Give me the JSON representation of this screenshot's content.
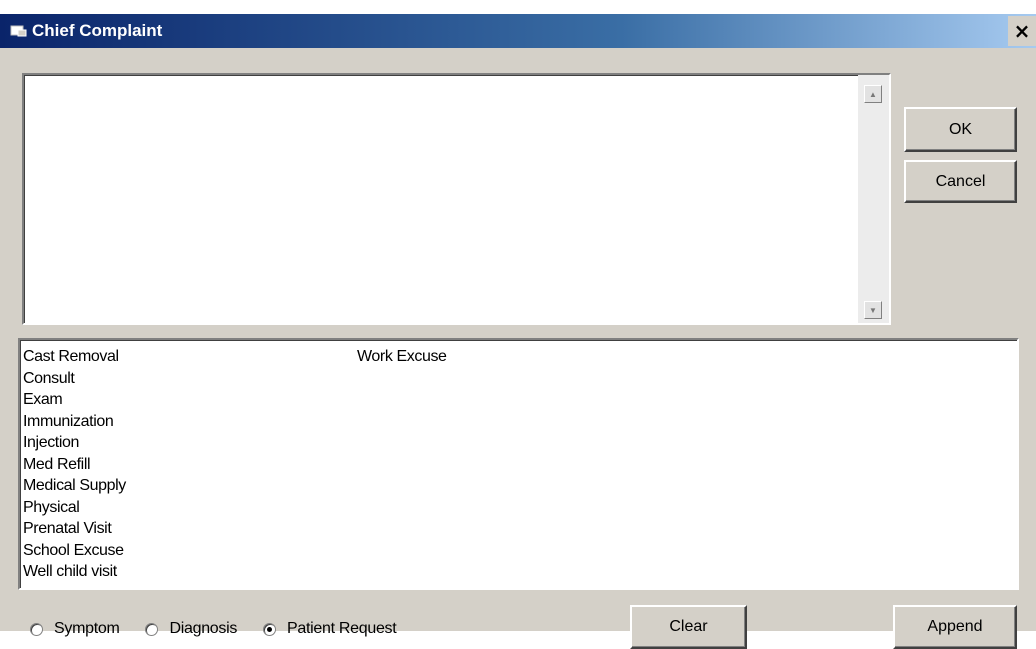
{
  "window": {
    "title": "Chief Complaint",
    "close_glyph": "×"
  },
  "complaint_text": {
    "value": "",
    "scroll_up_glyph": "▲",
    "scroll_down_glyph": "▼"
  },
  "buttons": {
    "ok": "OK",
    "cancel": "Cancel",
    "clear": "Clear",
    "append": "Append"
  },
  "list": {
    "column1": [
      "Cast Removal",
      "Consult",
      "Exam",
      "Immunization",
      "Injection",
      "Med Refill",
      "Medical Supply",
      "Physical",
      "Prenatal Visit",
      "School Excuse",
      "Well child visit"
    ],
    "column2": [
      "Work Excuse"
    ]
  },
  "radios": [
    {
      "label": "Symptom",
      "selected": false
    },
    {
      "label": "Diagnosis",
      "selected": false
    },
    {
      "label": "Patient Request",
      "selected": true
    }
  ],
  "colors": {
    "titlebar_start": "#0a246a",
    "titlebar_end": "#a6caf0",
    "face": "#d4d0c8"
  },
  "icons": {
    "title": "window-app-icon",
    "close": "close-icon"
  }
}
